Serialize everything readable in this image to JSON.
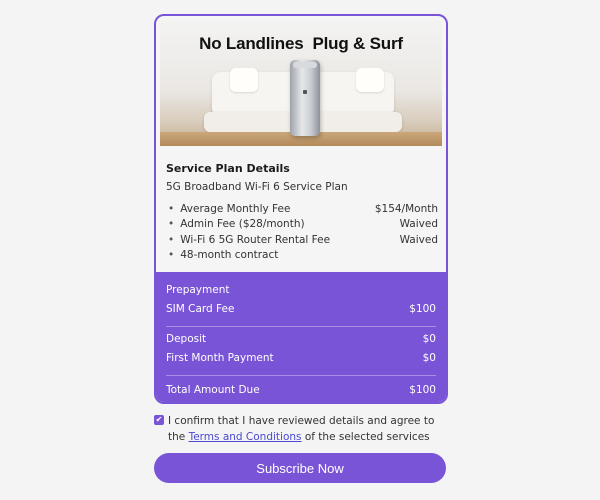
{
  "hero": {
    "title": "No Landlines  Plug & Surf"
  },
  "plan": {
    "title": "Service Plan Details",
    "name": "5G Broadband Wi-Fi 6 Service Plan",
    "fees": [
      {
        "label": "Average Monthly Fee",
        "value": "$154/Month"
      },
      {
        "label": "Admin Fee ($28/month)",
        "value": "Waived"
      },
      {
        "label": "Wi-Fi 6 5G Router Rental Fee",
        "value": "Waived"
      },
      {
        "label": "48-month contract",
        "value": ""
      }
    ]
  },
  "summary": {
    "prepayment_label": "Prepayment",
    "sim_label": "SIM Card Fee",
    "sim_value": "$100",
    "deposit_label": "Deposit",
    "deposit_value": "$0",
    "first_label": "First Month Payment",
    "first_value": "$0",
    "total_label": "Total Amount Due",
    "total_value": "$100"
  },
  "confirm": {
    "text_before": "I confirm that I have reviewed details and agree to the ",
    "link": "Terms and Conditions",
    "text_after": " of the selected services",
    "checked": true
  },
  "subscribe_label": "Subscribe Now",
  "colors": {
    "accent": "#7a54d6",
    "link": "#4a4ad0"
  }
}
